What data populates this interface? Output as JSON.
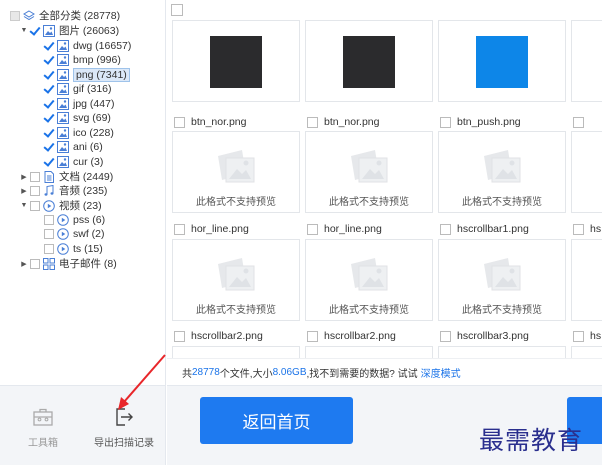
{
  "tree": {
    "root": {
      "label": "全部分类 (28778)"
    },
    "nodes": [
      {
        "label": "图片 (26063)",
        "icon": "image-icon"
      },
      {
        "label": "dwg (16657)",
        "icon": "image-icon"
      },
      {
        "label": "bmp (996)",
        "icon": "image-icon"
      },
      {
        "label": "png (7341)",
        "icon": "image-icon",
        "selected": true
      },
      {
        "label": "gif (316)",
        "icon": "image-icon"
      },
      {
        "label": "jpg (447)",
        "icon": "image-icon"
      },
      {
        "label": "svg (69)",
        "icon": "image-icon"
      },
      {
        "label": "ico (228)",
        "icon": "image-icon"
      },
      {
        "label": "ani (6)",
        "icon": "image-icon"
      },
      {
        "label": "cur (3)",
        "icon": "image-icon"
      },
      {
        "label": "文档 (2449)",
        "icon": "document-icon"
      },
      {
        "label": "音频 (235)",
        "icon": "music-icon"
      },
      {
        "label": "视频 (23)",
        "icon": "video-icon"
      },
      {
        "label": "pss (6)",
        "icon": "video-icon"
      },
      {
        "label": "swf (2)",
        "icon": "video-icon"
      },
      {
        "label": "ts (15)",
        "icon": "video-icon"
      },
      {
        "label": "电子邮件 (8)",
        "icon": "email-icon"
      }
    ]
  },
  "toolbar": {
    "toolbox_label": "工具箱",
    "export_label": "导出扫描记录"
  },
  "files": {
    "row1": [
      "btn_nor.png",
      "btn_nor.png",
      "btn_push.png"
    ],
    "row2": [
      "hor_line.png",
      "hor_line.png",
      "hscrollbar1.png"
    ],
    "row3": [
      "hscrollbar2.png",
      "hscrollbar2.png",
      "hscrollbar3.png"
    ],
    "truncated": [
      "hs",
      "hs"
    ],
    "no_preview_text": "此格式不支持预览",
    "swatch_colors": [
      "#2b2b2d",
      "#2b2b2d",
      "#0d86e8"
    ]
  },
  "info": {
    "prefix": "共",
    "count": "28778",
    "mid": "个文件,大小",
    "size": "8.06GB",
    "suffix": ",找不到需要的数据? 试试",
    "link": "深度模式"
  },
  "actions": {
    "home_label": "返回首页"
  },
  "watermark": "最需教育",
  "colors": {
    "accent": "#1e7af0",
    "annotation": "#e8262a"
  }
}
